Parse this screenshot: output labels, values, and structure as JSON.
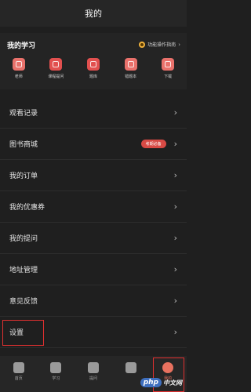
{
  "header": {
    "title": "我的"
  },
  "study": {
    "title": "我的学习",
    "guide_link": "功能操作指南",
    "guide_arrow": "›",
    "quick_items": [
      {
        "label": "老师",
        "icon": "teacher-icon"
      },
      {
        "label": "课程提问",
        "icon": "question-icon"
      },
      {
        "label": "题库",
        "icon": "question-bank-icon"
      },
      {
        "label": "错题本",
        "icon": "notebook-icon"
      },
      {
        "label": "下载",
        "icon": "download-icon"
      }
    ]
  },
  "menu": {
    "items": [
      {
        "label": "观看记录"
      },
      {
        "label": "图书商城",
        "badge": "考期必备"
      },
      {
        "label": "我的订单"
      },
      {
        "label": "我的优惠券"
      },
      {
        "label": "我的提问"
      },
      {
        "label": "地址管理"
      },
      {
        "label": "意见反馈"
      },
      {
        "label": "设置"
      }
    ],
    "chevron": "›"
  },
  "tabbar": {
    "tabs": [
      {
        "label": "首页",
        "icon": "home-icon"
      },
      {
        "label": "学习",
        "icon": "study-icon"
      },
      {
        "label": "提问",
        "icon": "ask-icon"
      },
      {
        "label": "",
        "icon": "center-icon"
      },
      {
        "label": "我的",
        "icon": "profile-icon",
        "active": true
      }
    ]
  },
  "watermark": {
    "logo": "php",
    "text": "中文网"
  },
  "colors": {
    "accent": "#d94a45",
    "background": "#1f1f1f",
    "highlight_box": "#e03030"
  }
}
